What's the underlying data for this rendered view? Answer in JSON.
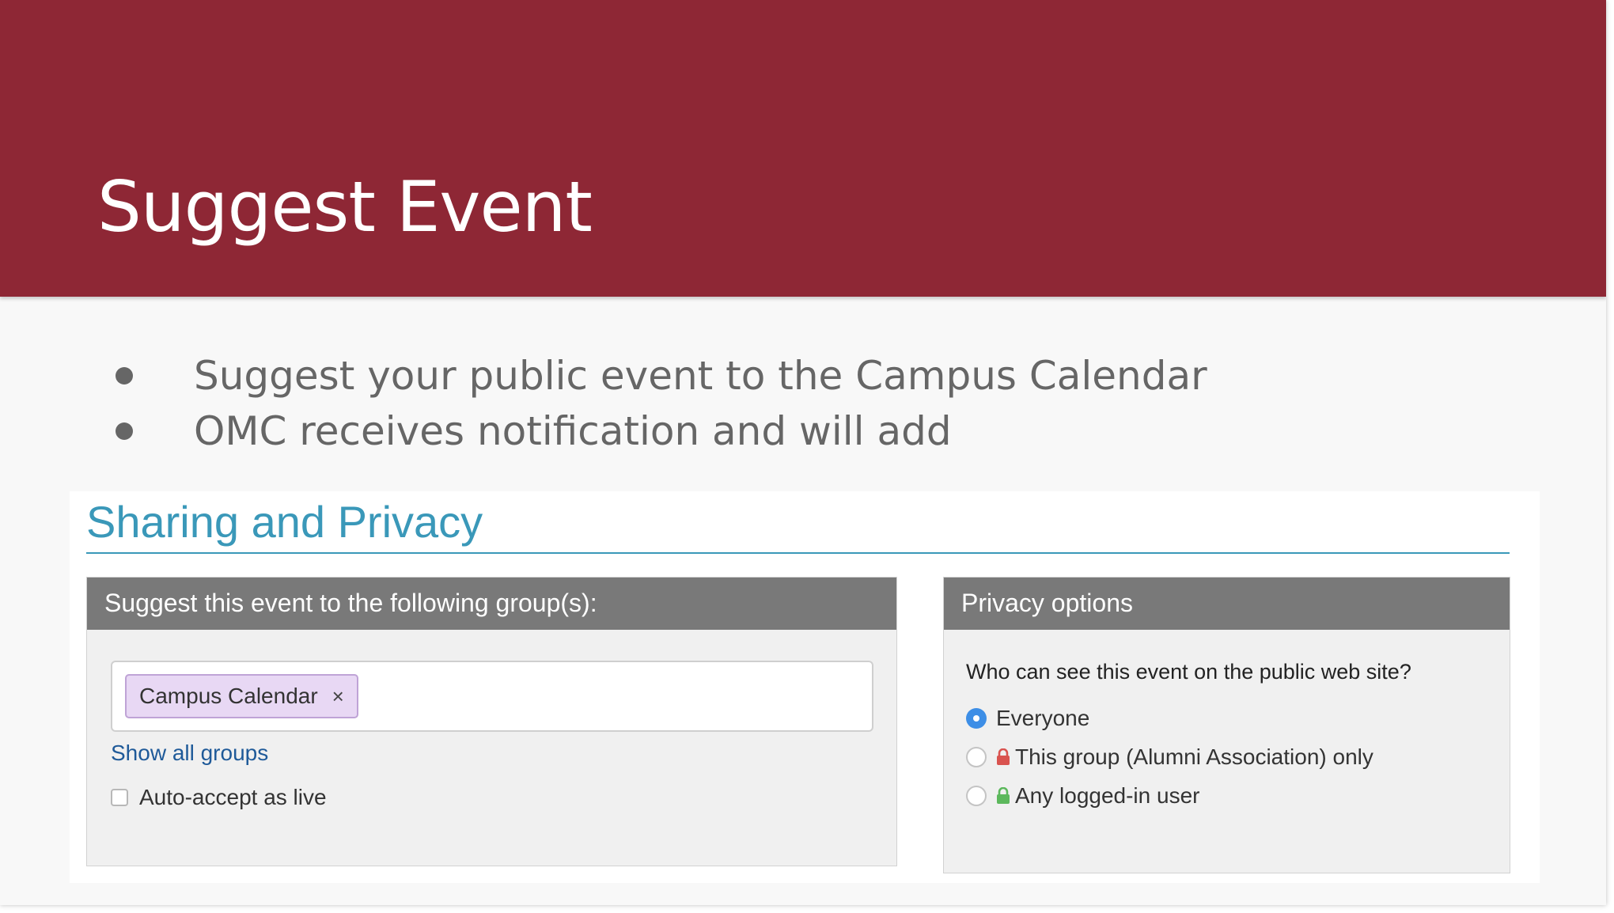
{
  "slide": {
    "title": "Suggest Event",
    "bullets": [
      "Suggest your public event to the Campus Calendar",
      "OMC receives notification and will add"
    ]
  },
  "sharing": {
    "section_title": "Sharing and Privacy",
    "groups_panel": {
      "heading": "Suggest this event to the following group(s):",
      "selected_tag": "Campus Calendar",
      "remove_symbol": "×",
      "show_all_link": "Show all groups",
      "auto_accept_label": "Auto-accept as live",
      "auto_accept_checked": false
    },
    "privacy_panel": {
      "heading": "Privacy options",
      "question": "Who can see this event on the public web site?",
      "options": [
        {
          "label": "Everyone",
          "selected": true,
          "lock": null
        },
        {
          "label": "This group (Alumni Association) only",
          "selected": false,
          "lock": "red-lock-icon"
        },
        {
          "label": "Any logged-in user",
          "selected": false,
          "lock": "green-lock-icon"
        }
      ]
    }
  },
  "colors": {
    "header_band": "#8e2735",
    "section_accent": "#3a98b9",
    "panel_header": "#797979",
    "tag_bg": "#e8d8f4",
    "link": "#1f5a99",
    "radio_selected": "#3d8ee6",
    "lock_red": "#d9534f",
    "lock_green": "#5cb85c"
  }
}
